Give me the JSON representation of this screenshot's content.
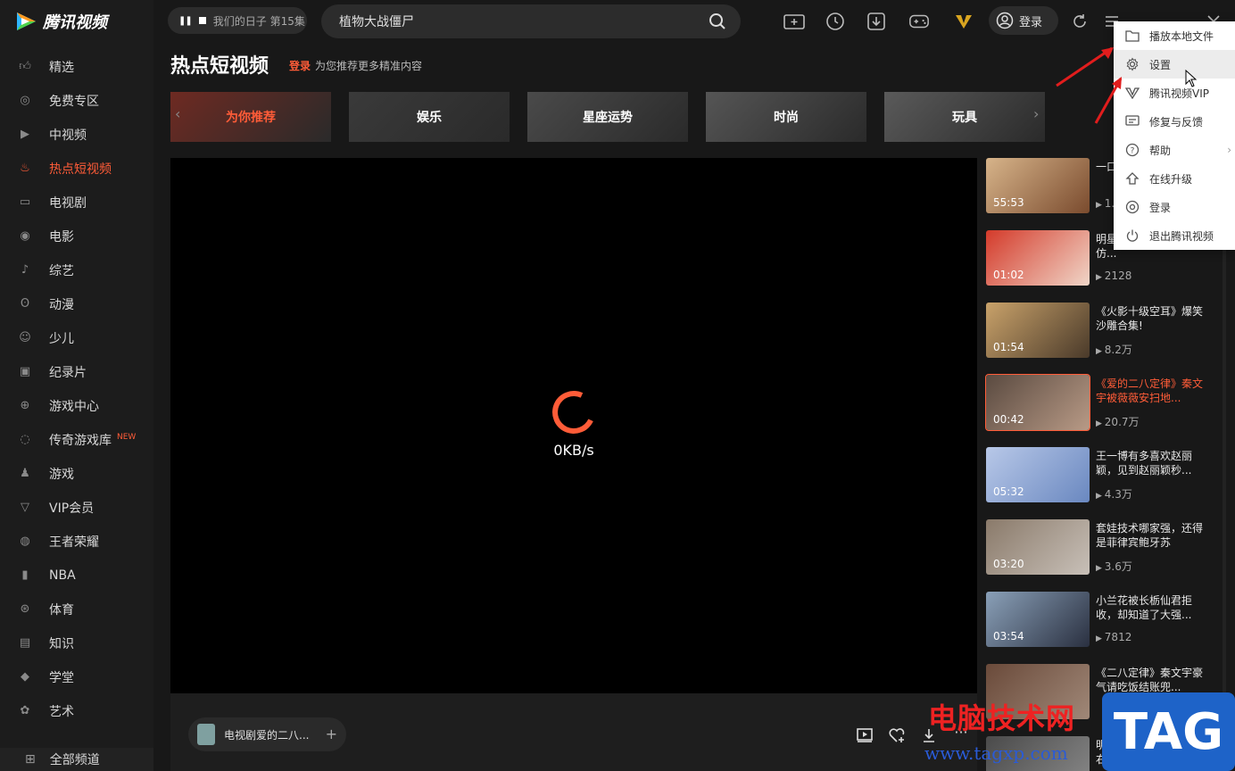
{
  "app": {
    "logo_text": "腾讯视频"
  },
  "sidebar": {
    "items": [
      {
        "label": "精选",
        "icon": "thumbs-up-icon"
      },
      {
        "label": "免费专区",
        "icon": "film-reel-icon"
      },
      {
        "label": "中视频",
        "icon": "play-square-icon"
      },
      {
        "label": "热点短视频",
        "icon": "flame-icon",
        "active": true
      },
      {
        "label": "电视剧",
        "icon": "tv-icon"
      },
      {
        "label": "电影",
        "icon": "film-icon"
      },
      {
        "label": "综艺",
        "icon": "microphone-icon"
      },
      {
        "label": "动漫",
        "icon": "bear-icon"
      },
      {
        "label": "少儿",
        "icon": "child-icon"
      },
      {
        "label": "纪录片",
        "icon": "camera-icon"
      },
      {
        "label": "游戏中心",
        "icon": "gamepad-icon"
      },
      {
        "label": "传奇游戏库",
        "icon": "fire-ring-icon",
        "badge": "NEW"
      },
      {
        "label": "游戏",
        "icon": "person-icon"
      },
      {
        "label": "VIP会员",
        "icon": "vip-icon"
      },
      {
        "label": "王者荣耀",
        "icon": "compass-icon"
      },
      {
        "label": "NBA",
        "icon": "nba-icon"
      },
      {
        "label": "体育",
        "icon": "basketball-icon"
      },
      {
        "label": "知识",
        "icon": "book-icon"
      },
      {
        "label": "学堂",
        "icon": "graduation-cap-icon"
      },
      {
        "label": "艺术",
        "icon": "palette-icon"
      }
    ],
    "all_channels": "全部频道"
  },
  "topbar": {
    "mini_player_text": "我们的日子 第15集",
    "search_value": "植物大战僵尸",
    "login_label": "登录"
  },
  "page": {
    "title": "热点短视频",
    "login_link": "登录",
    "subtitle": "为您推荐更多精准内容"
  },
  "categories": [
    {
      "label": "为你推荐",
      "active": true
    },
    {
      "label": "娱乐"
    },
    {
      "label": "星座运势"
    },
    {
      "label": "时尚"
    },
    {
      "label": "玩具"
    }
  ],
  "player": {
    "speed": "0KB/s",
    "now_playing": "电视剧爱的二八..."
  },
  "videos": [
    {
      "duration": "55:53",
      "title": "一口...穿越...",
      "views": "1..."
    },
    {
      "duration": "01:02",
      "title": "明星...割韭菜，倪妮效仿...",
      "views": "2128"
    },
    {
      "duration": "01:54",
      "title": "《火影十级空耳》爆笑沙雕合集!",
      "views": "8.2万"
    },
    {
      "duration": "00:42",
      "title": "《爱的二八定律》秦文宇被薇薇安扫地...",
      "views": "20.7万",
      "active": true
    },
    {
      "duration": "05:32",
      "title": "王一博有多喜欢赵丽颖，见到赵丽颖秒...",
      "views": "4.3万"
    },
    {
      "duration": "03:20",
      "title": "套娃技术哪家强，还得是菲律宾鲍牙苏",
      "views": "3.6万"
    },
    {
      "duration": "03:54",
      "title": "小兰花被长栃仙君拒收，却知道了大强...",
      "views": "7812"
    },
    {
      "duration": "",
      "title": "《二八定律》秦文宇豪气请吃饭结账兜...",
      "views": ""
    },
    {
      "duration": "",
      "title": "明星...现了！杨幂左右...",
      "views": ""
    }
  ],
  "menu": {
    "items": [
      {
        "label": "播放本地文件",
        "icon": "folder-icon"
      },
      {
        "label": "设置",
        "icon": "gear-icon",
        "hover": true
      },
      {
        "label": "腾讯视频VIP",
        "icon": "vip-icon"
      },
      {
        "label": "修复与反馈",
        "icon": "feedback-icon"
      },
      {
        "label": "帮助",
        "icon": "help-icon",
        "submenu": true
      },
      {
        "label": "在线升级",
        "icon": "upgrade-icon"
      },
      {
        "label": "登录",
        "icon": "login-icon"
      },
      {
        "label": "退出腾讯视频",
        "icon": "power-icon"
      }
    ]
  },
  "watermark": {
    "site_name": "电脑技术网",
    "url": "www.tagxp.com",
    "tag": "TAG"
  },
  "colors": {
    "accent": "#ff5c38",
    "annotation_arrow": "#e11d1d"
  }
}
